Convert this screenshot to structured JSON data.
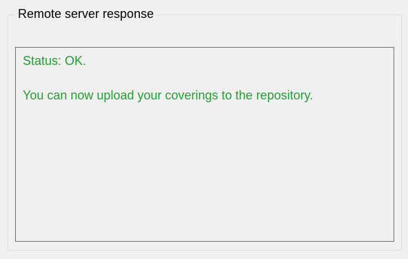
{
  "group": {
    "title": "Remote server response"
  },
  "response": {
    "status_line": "Status: OK.",
    "message_line": "You can now upload your coverings to the repository.",
    "text_color": "#20a030"
  }
}
